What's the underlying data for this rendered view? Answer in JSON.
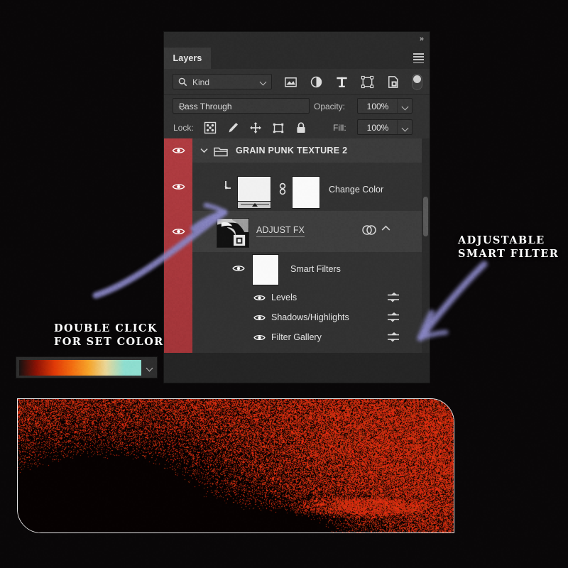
{
  "panel": {
    "tab_label": "Layers",
    "collapse_icon": "double-chevron-right",
    "menu_icon": "hamburger",
    "filter": {
      "search_icon": "search-icon",
      "kind_label": "Kind",
      "chevron": "chevron-down-icon",
      "icons": [
        "pixel-layer-filter-icon",
        "adjustment-layer-filter-icon",
        "type-layer-filter-icon",
        "shape-layer-filter-icon",
        "smart-object-filter-icon",
        "filter-toggle-switch"
      ]
    },
    "blend": {
      "mode": "Pass Through",
      "opacity_label": "Opacity:",
      "opacity_value": "100%"
    },
    "lock": {
      "label": "Lock:",
      "icons": [
        "lock-transparent-pixels-icon",
        "lock-image-pixels-icon",
        "lock-position-icon",
        "lock-artboard-nesting-icon",
        "lock-all-icon"
      ],
      "fill_label": "Fill:",
      "fill_value": "100%"
    },
    "layers": [
      {
        "name": "GRAIN PUNK TEXTURE 2",
        "type": "group",
        "icon": "folder-icon",
        "expanded": true,
        "visible": true,
        "selected": false
      },
      {
        "name": "Change Color",
        "type": "gradient-map",
        "icon": "clipping-mask-arrow-icon",
        "link_icon": "link-icon",
        "visible": true,
        "selected": false
      },
      {
        "name": "ADJUST FX",
        "type": "smart-object",
        "badge": "smart-object-badge-icon",
        "fx_icon": "smart-filter-icon",
        "collapse_icon": "chevron-up-icon",
        "visible": true,
        "selected": true
      },
      {
        "name": "Smart Filters",
        "type": "smart-filters-header",
        "visible": true,
        "selected": false
      }
    ],
    "smart_filters": [
      {
        "name": "Levels",
        "visible": true,
        "settings_icon": "filter-settings-icon"
      },
      {
        "name": "Shadows/Highlights",
        "visible": true,
        "settings_icon": "filter-settings-icon"
      },
      {
        "name": "Filter Gallery",
        "visible": true,
        "settings_icon": "filter-settings-icon"
      }
    ],
    "scrollbar": "vertical-scrollbar"
  },
  "annotations": {
    "left": "DOUBLE CLICK\nFOR SET COLOR",
    "left_line1": "DOUBLE CLICK",
    "left_line2": "FOR SET COLOR",
    "right_line1": "ADJUSTABLE",
    "right_line2": "SMART FILTER",
    "arrow_color": "#8a87c6"
  },
  "gradient_swatch": {
    "name": "gradient-preview",
    "chevron": "chevron-down-icon",
    "stops": [
      "#161110",
      "#8d1205",
      "#e03a07",
      "#f26d10",
      "#f6a52a",
      "#e9d79a",
      "#8fded0",
      "#8fded0"
    ]
  },
  "hero_image": {
    "name": "grain-punk-texture-preview",
    "accent": "#c42d14",
    "background": "#0b0202"
  },
  "colors": {
    "panel_bg": "#323232",
    "panel_header": "#2b2b2b",
    "tab_active": "#3a3a3a",
    "visibility_column": "#ab3a3f",
    "page_bg": "#090708",
    "text": "#e6e6e6",
    "selected_row": "#474747"
  }
}
